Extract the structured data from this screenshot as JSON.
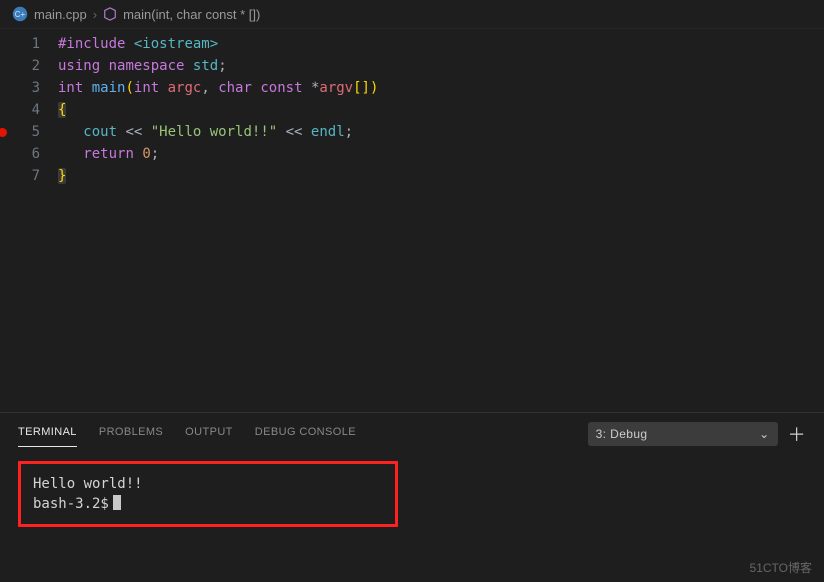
{
  "breadcrumb": {
    "file": "main.cpp",
    "symbol": "main(int, char const * [])"
  },
  "code": {
    "lines": [
      {
        "num": "1",
        "bp": false
      },
      {
        "num": "2",
        "bp": false
      },
      {
        "num": "3",
        "bp": false
      },
      {
        "num": "4",
        "bp": false
      },
      {
        "num": "5",
        "bp": true
      },
      {
        "num": "6",
        "bp": false
      },
      {
        "num": "7",
        "bp": false
      }
    ],
    "tokens": {
      "include_kw": "#include",
      "include_hdr": "<iostream>",
      "using": "using",
      "namespace": "namespace",
      "ns": "std",
      "semi": ";",
      "int": "int",
      "main": "main",
      "lpar": "(",
      "rpar": ")",
      "argc": "argc",
      "char": "char",
      "const": "const",
      "star": "*",
      "argv": "argv",
      "br_l": "[",
      "br_r": "]",
      "lbrace": "{",
      "rbrace": "}",
      "cout": "cout",
      "ins": "<<",
      "hello": "\"Hello world!!\"",
      "endl": "endl",
      "return": "return",
      "zero": "0"
    }
  },
  "panel": {
    "tabs": {
      "terminal": "TERMINAL",
      "problems": "PROBLEMS",
      "output": "OUTPUT",
      "debug": "DEBUG CONSOLE"
    },
    "selector": "3: Debug",
    "out_line1": "Hello world!!",
    "prompt": "bash-3.2$"
  },
  "watermark": "51CTO博客"
}
